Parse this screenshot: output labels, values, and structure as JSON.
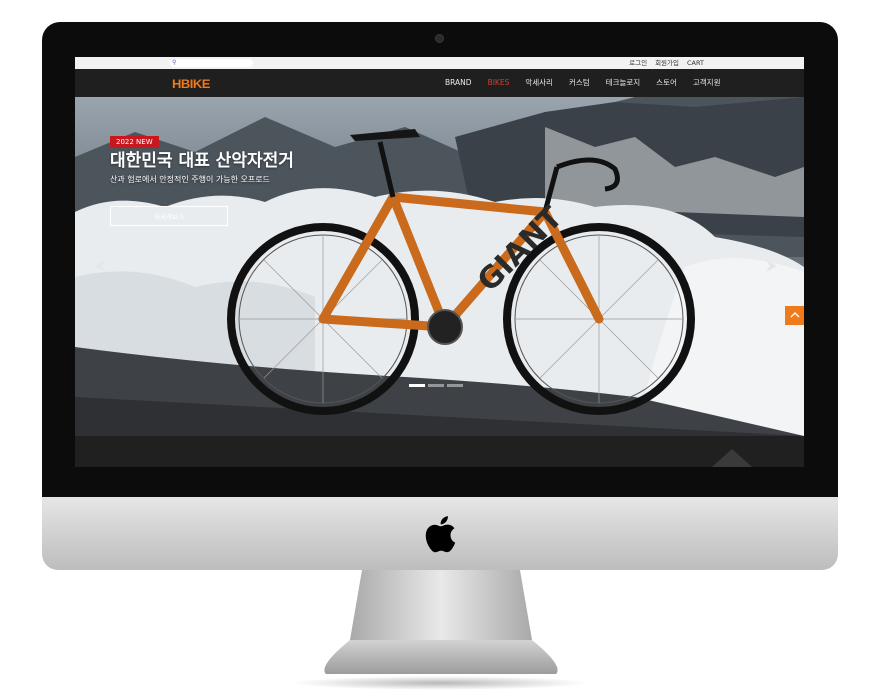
{
  "top_links": [
    "로그인",
    "회원가입",
    "CART"
  ],
  "logo": "HBIKE",
  "nav": [
    {
      "label": "BRAND",
      "active": false
    },
    {
      "label": "BIKES",
      "active": true
    },
    {
      "label": "악세사리",
      "active": false
    },
    {
      "label": "커스텀",
      "active": false
    },
    {
      "label": "테크놀로지",
      "active": false
    },
    {
      "label": "스토어",
      "active": false
    },
    {
      "label": "고객지원",
      "active": false
    }
  ],
  "hero": {
    "badge": "2022 NEW",
    "headline": "대한민국 대표 산악자전거",
    "subline": "산과 험로에서 안정적인 주행이 가능한 오프로드",
    "button": "자세히보기",
    "slide_index": 1,
    "slide_count": 3
  },
  "colors": {
    "accent": "#f07a1a",
    "badge": "#c8171e",
    "active_nav": "#e03a2a"
  },
  "icons": {
    "search": "search-icon",
    "prev": "chevron-left-icon",
    "next": "chevron-right-icon",
    "top": "chevron-up-icon",
    "brand": "apple-logo"
  }
}
